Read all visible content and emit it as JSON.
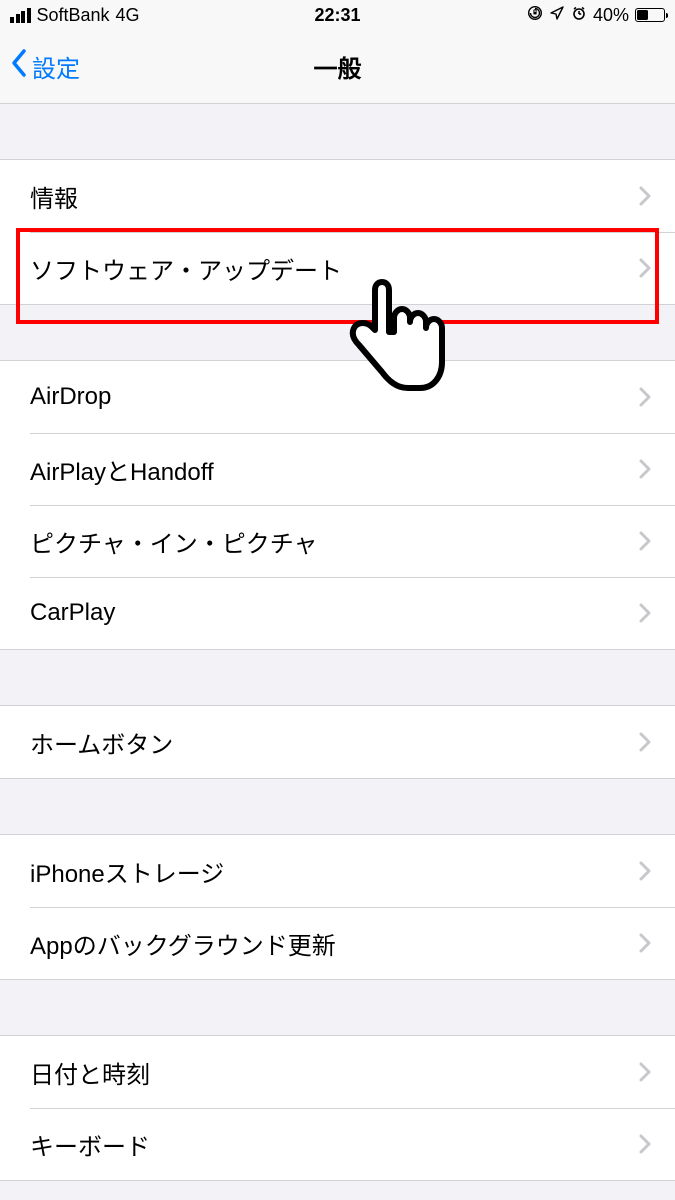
{
  "status": {
    "carrier": "SoftBank",
    "network": "4G",
    "time": "22:31",
    "battery_pct": "40%"
  },
  "nav": {
    "back_label": "設定",
    "title": "一般"
  },
  "groups": [
    {
      "rows": [
        {
          "label": "情報"
        },
        {
          "label": "ソフトウェア・アップデート"
        }
      ]
    },
    {
      "rows": [
        {
          "label": "AirDrop"
        },
        {
          "label": "AirPlayとHandoff"
        },
        {
          "label": "ピクチャ・イン・ピクチャ"
        },
        {
          "label": "CarPlay"
        }
      ]
    },
    {
      "rows": [
        {
          "label": "ホームボタン"
        }
      ]
    },
    {
      "rows": [
        {
          "label": "iPhoneストレージ"
        },
        {
          "label": "Appのバックグラウンド更新"
        }
      ]
    },
    {
      "rows": [
        {
          "label": "日付と時刻"
        },
        {
          "label": "キーボード"
        }
      ]
    }
  ]
}
